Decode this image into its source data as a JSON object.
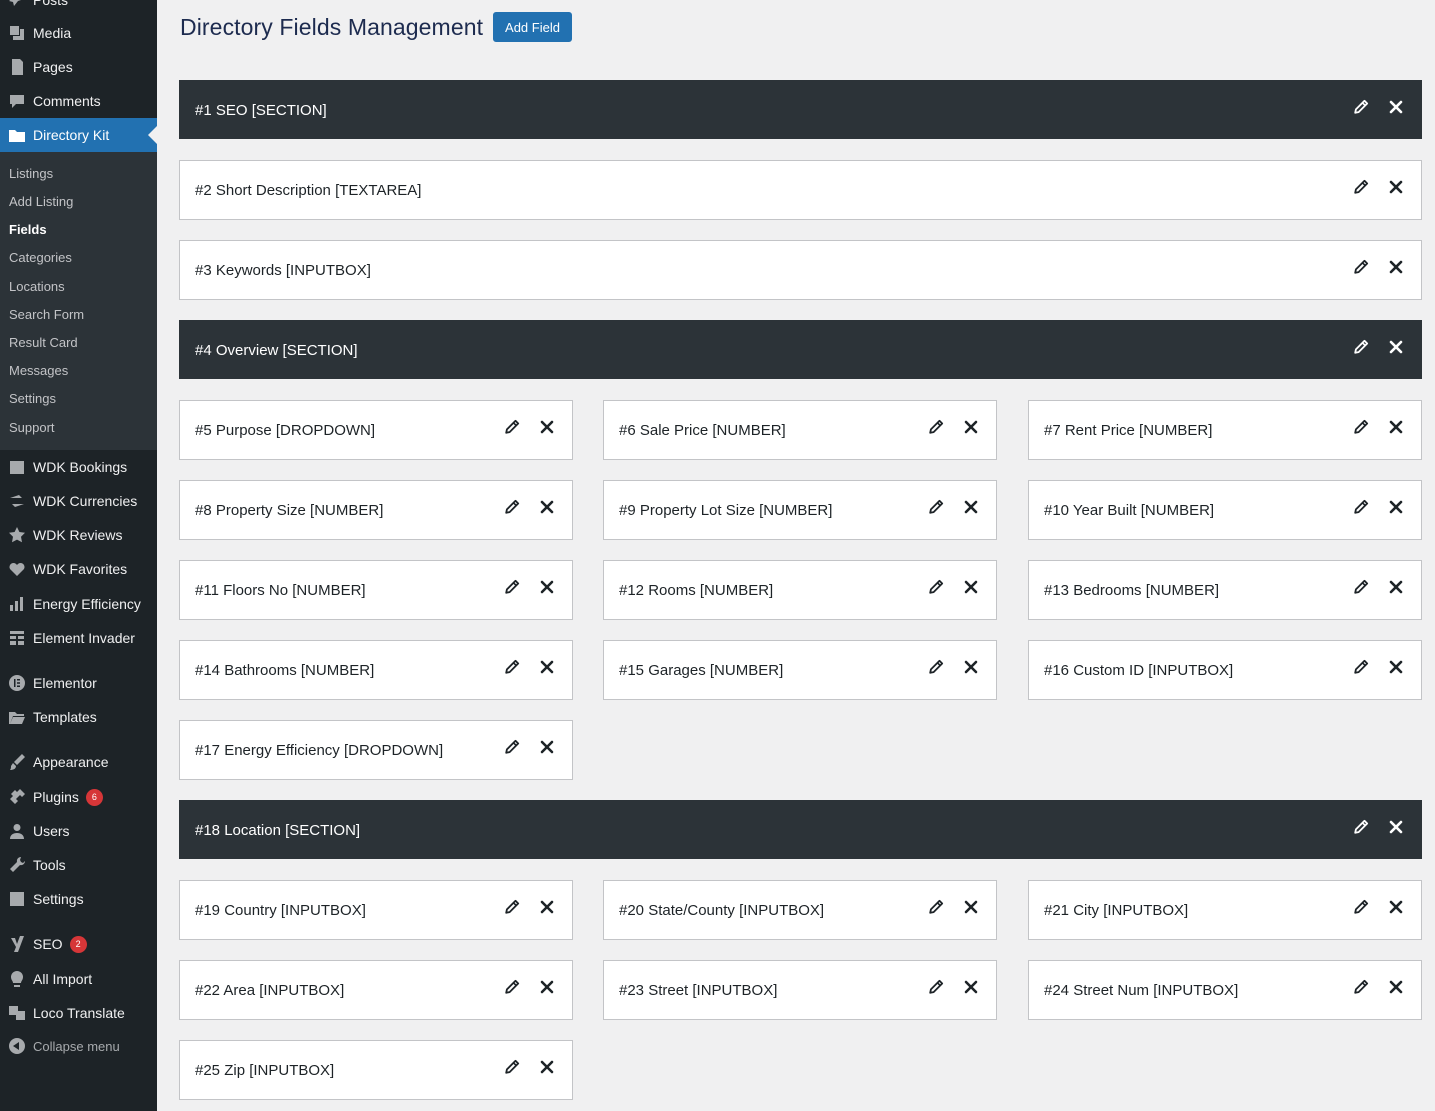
{
  "sidebar": {
    "top_items": [
      {
        "label": "Posts",
        "icon": "pin-icon"
      },
      {
        "label": "Media",
        "icon": "media-icon"
      },
      {
        "label": "Pages",
        "icon": "pages-icon"
      },
      {
        "label": "Comments",
        "icon": "comments-icon"
      },
      {
        "label": "Directory Kit",
        "icon": "folder-icon"
      }
    ],
    "submenu": [
      "Listings",
      "Add Listing",
      "Fields",
      "Categories",
      "Locations",
      "Search Form",
      "Result Card",
      "Messages",
      "Settings",
      "Support"
    ],
    "submenu_current": "Fields",
    "bottom_items": [
      {
        "label": "WDK Bookings",
        "icon": "calendar-icon"
      },
      {
        "label": "WDK Currencies",
        "icon": "exchange-icon"
      },
      {
        "label": "WDK Reviews",
        "icon": "star-icon"
      },
      {
        "label": "WDK Favorites",
        "icon": "heart-icon"
      },
      {
        "label": "Energy Efficiency",
        "icon": "bar-chart-icon"
      },
      {
        "label": "Element Invader",
        "icon": "grid-icon"
      },
      {
        "label": "Elementor",
        "icon": "elementor-icon"
      },
      {
        "label": "Templates",
        "icon": "folder-open-icon"
      },
      {
        "label": "Appearance",
        "icon": "brush-icon"
      },
      {
        "label": "Plugins",
        "icon": "plugin-icon",
        "badge": "6"
      },
      {
        "label": "Users",
        "icon": "user-icon"
      },
      {
        "label": "Tools",
        "icon": "wrench-icon"
      },
      {
        "label": "Settings",
        "icon": "settings-icon"
      },
      {
        "label": "SEO",
        "icon": "yoast-icon",
        "badge": "2"
      },
      {
        "label": "All Import",
        "icon": "import-icon"
      },
      {
        "label": "Loco Translate",
        "icon": "translate-icon"
      }
    ],
    "collapse_label": "Collapse menu"
  },
  "header": {
    "title": "Directory Fields Management",
    "add_button": "Add Field"
  },
  "fields": [
    {
      "label": "#1 SEO [SECTION]",
      "type": "section"
    },
    {
      "label": "#2 Short Description [TEXTAREA]",
      "type": "full"
    },
    {
      "label": "#3 Keywords [INPUTBOX]",
      "type": "full"
    },
    {
      "label": "#4 Overview [SECTION]",
      "type": "section"
    },
    {
      "label": "#5 Purpose [DROPDOWN]",
      "type": "third"
    },
    {
      "label": "#6 Sale Price [NUMBER]",
      "type": "third"
    },
    {
      "label": "#7 Rent Price [NUMBER]",
      "type": "third"
    },
    {
      "label": "#8 Property Size [NUMBER]",
      "type": "third"
    },
    {
      "label": "#9 Property Lot Size [NUMBER]",
      "type": "third"
    },
    {
      "label": "#10 Year Built [NUMBER]",
      "type": "third"
    },
    {
      "label": "#11 Floors No [NUMBER]",
      "type": "third"
    },
    {
      "label": "#12 Rooms [NUMBER]",
      "type": "third"
    },
    {
      "label": "#13 Bedrooms [NUMBER]",
      "type": "third"
    },
    {
      "label": "#14 Bathrooms [NUMBER]",
      "type": "third"
    },
    {
      "label": "#15 Garages [NUMBER]",
      "type": "third"
    },
    {
      "label": "#16 Custom ID [INPUTBOX]",
      "type": "third"
    },
    {
      "label": "#17 Energy Efficiency [DROPDOWN]",
      "type": "third"
    },
    {
      "label": "#18 Location [SECTION]",
      "type": "section"
    },
    {
      "label": "#19 Country [INPUTBOX]",
      "type": "third"
    },
    {
      "label": "#20 State/County [INPUTBOX]",
      "type": "third"
    },
    {
      "label": "#21 City [INPUTBOX]",
      "type": "third"
    },
    {
      "label": "#22 Area [INPUTBOX]",
      "type": "third"
    },
    {
      "label": "#23 Street [INPUTBOX]",
      "type": "third"
    },
    {
      "label": "#24 Street Num [INPUTBOX]",
      "type": "third"
    },
    {
      "label": "#25 Zip [INPUTBOX]",
      "type": "third"
    }
  ],
  "colors": {
    "accent": "#2271b1",
    "sidebar": "#1d2327",
    "section": "#2c3338",
    "badge": "#d63638"
  }
}
